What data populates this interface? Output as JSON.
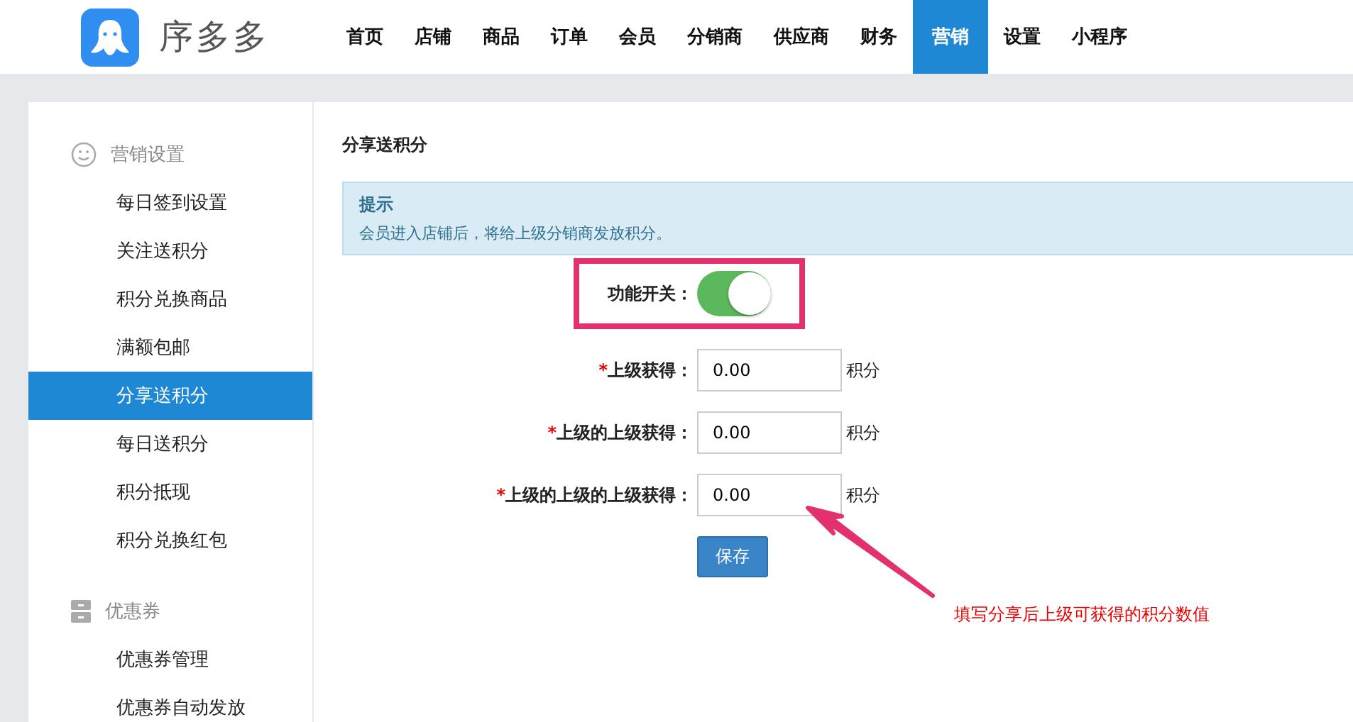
{
  "header": {
    "brand": "序多多",
    "nav": [
      {
        "label": "首页",
        "selected": false
      },
      {
        "label": "店铺",
        "selected": false
      },
      {
        "label": "商品",
        "selected": false
      },
      {
        "label": "订单",
        "selected": false
      },
      {
        "label": "会员",
        "selected": false
      },
      {
        "label": "分销商",
        "selected": false
      },
      {
        "label": "供应商",
        "selected": false
      },
      {
        "label": "财务",
        "selected": false
      },
      {
        "label": "营销",
        "selected": true
      },
      {
        "label": "设置",
        "selected": false
      },
      {
        "label": "小程序",
        "selected": false
      }
    ]
  },
  "sidebar": {
    "groups": [
      {
        "kind": "smile",
        "title": "营销设置",
        "items": [
          {
            "label": "每日签到设置",
            "selected": false
          },
          {
            "label": "关注送积分",
            "selected": false
          },
          {
            "label": "积分兑换商品",
            "selected": false
          },
          {
            "label": "满额包邮",
            "selected": false
          },
          {
            "label": "分享送积分",
            "selected": true
          },
          {
            "label": "每日送积分",
            "selected": false
          },
          {
            "label": "积分抵现",
            "selected": false
          },
          {
            "label": "积分兑换红包",
            "selected": false
          }
        ]
      },
      {
        "kind": "cabinet",
        "title": "优惠券",
        "items": [
          {
            "label": "优惠券管理",
            "selected": false
          },
          {
            "label": "优惠券自动发放",
            "selected": false
          }
        ]
      }
    ]
  },
  "page": {
    "title": "分享送积分",
    "tip": {
      "title": "提示",
      "text": "会员进入店铺后，将给上级分销商发放积分。"
    },
    "switch": {
      "label": "功能开关：",
      "on": true
    },
    "fields": [
      {
        "marker": "*",
        "label": "上级获得：",
        "value": "0.00",
        "unit": "积分"
      },
      {
        "marker": "*",
        "label": "上级的上级获得：",
        "value": "0.00",
        "unit": "积分"
      },
      {
        "marker": "*",
        "label": "上级的上级的上级获得：",
        "value": "0.00",
        "unit": "积分"
      }
    ],
    "save_button": "保存",
    "annotation": "填写分享后上级可获得的积分数值"
  }
}
